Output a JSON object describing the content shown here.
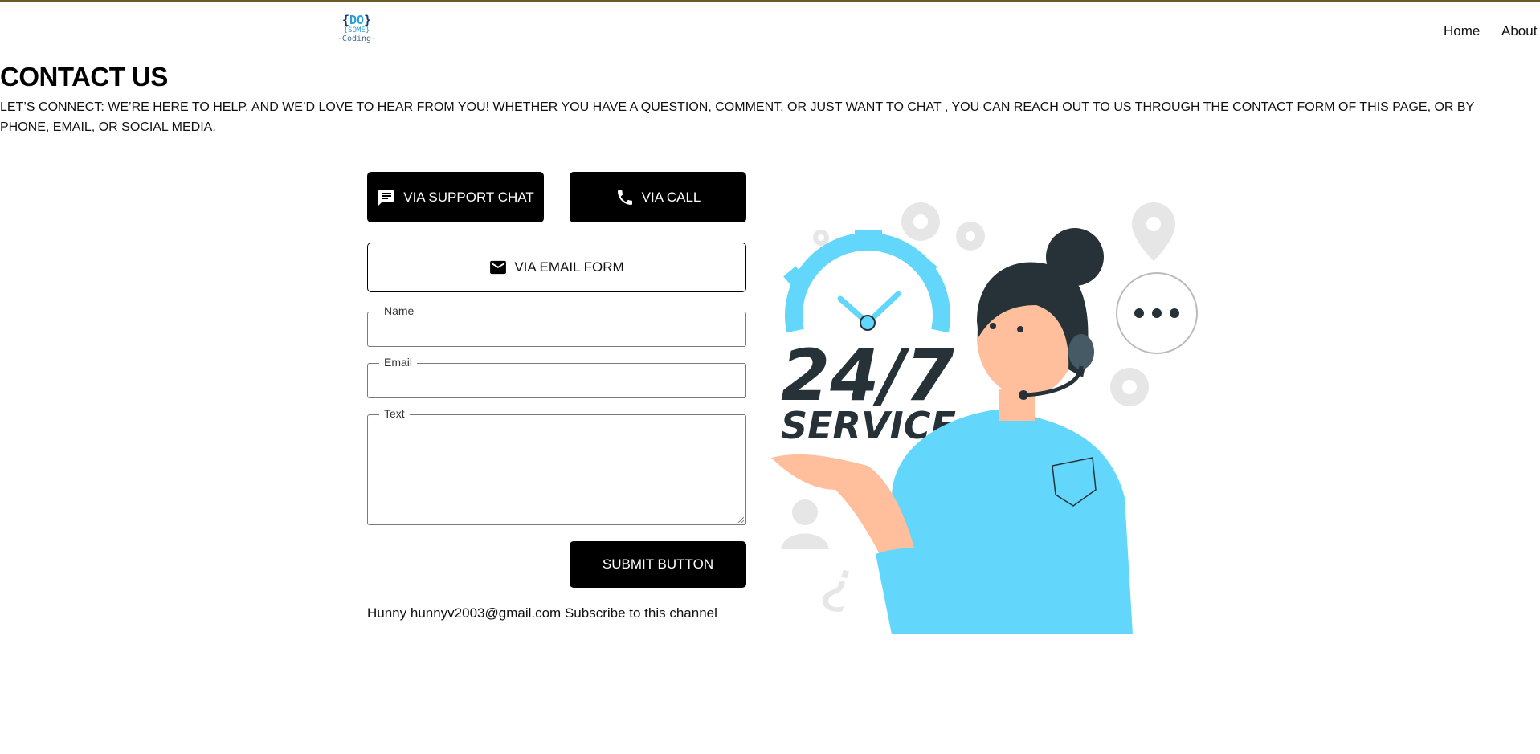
{
  "header": {
    "logo": {
      "line1_open": "{",
      "line1_text": "DO",
      "line1_close": "}",
      "line2": "{SOME}",
      "line3": "-Coding-"
    },
    "nav": [
      "Home",
      "About"
    ]
  },
  "page": {
    "title": "CONTACT US",
    "intro": "Let’s connect: We’re here to help, and we’d love to hear from you! Whether you have a question, comment, or just want to chat , you can reach out to us through the contact form of this page, or by phone, email, or social media."
  },
  "contact_buttons": {
    "chat": {
      "label": "VIA SUPPORT CHAT",
      "icon": "chat-icon"
    },
    "call": {
      "label": "VIA CALL",
      "icon": "phone-icon"
    },
    "email": {
      "label": "VIA EMAIL FORM",
      "icon": "mail-icon"
    }
  },
  "form": {
    "name_label": "Name",
    "email_label": "Email",
    "text_label": "Text",
    "submit_label": "SUBMIT BUTTON"
  },
  "footer": {
    "text": "Hunny hunnyv2003@gmail.com Subscribe to this channel"
  },
  "illustration": {
    "headline": "24/7",
    "subline": "SERVICE"
  },
  "colors": {
    "accent": "#62d6fb",
    "dark": "#263238",
    "button_bg": "#000000",
    "top_border": "#6b5a2a"
  }
}
